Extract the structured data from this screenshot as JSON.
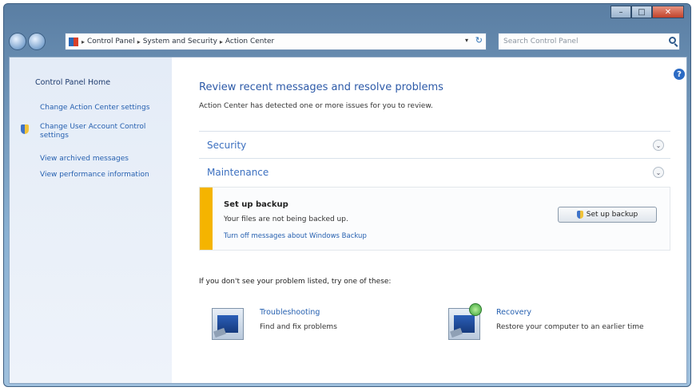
{
  "window": {
    "caption_buttons": {
      "minimize": "–",
      "maximize": "□",
      "close": "✕"
    }
  },
  "navbar": {
    "breadcrumbs": [
      "Control Panel",
      "System and Security",
      "Action Center"
    ],
    "breadcrumb_separator": "▸",
    "search_placeholder": "Search Control Panel"
  },
  "sidebar": {
    "home": "Control Panel Home",
    "links": [
      "Change Action Center settings",
      "Change User Account Control settings",
      "View archived messages",
      "View performance information"
    ]
  },
  "main": {
    "title": "Review recent messages and resolve problems",
    "subtitle": "Action Center has detected one or more issues for you to review.",
    "sections": [
      {
        "label": "Security"
      },
      {
        "label": "Maintenance"
      }
    ],
    "alert": {
      "title": "Set up backup",
      "description": "Your files are not being backed up.",
      "link": "Turn off messages about Windows Backup",
      "button": "Set up backup"
    },
    "hint": "If you don't see your problem listed, try one of these:",
    "tools": [
      {
        "name": "Troubleshooting",
        "description": "Find and fix problems"
      },
      {
        "name": "Recovery",
        "description": "Restore your computer to an earlier time"
      }
    ]
  },
  "colors": {
    "alert_bar": "#f5b400",
    "link": "#2660b0",
    "title": "#2d5aa8"
  }
}
